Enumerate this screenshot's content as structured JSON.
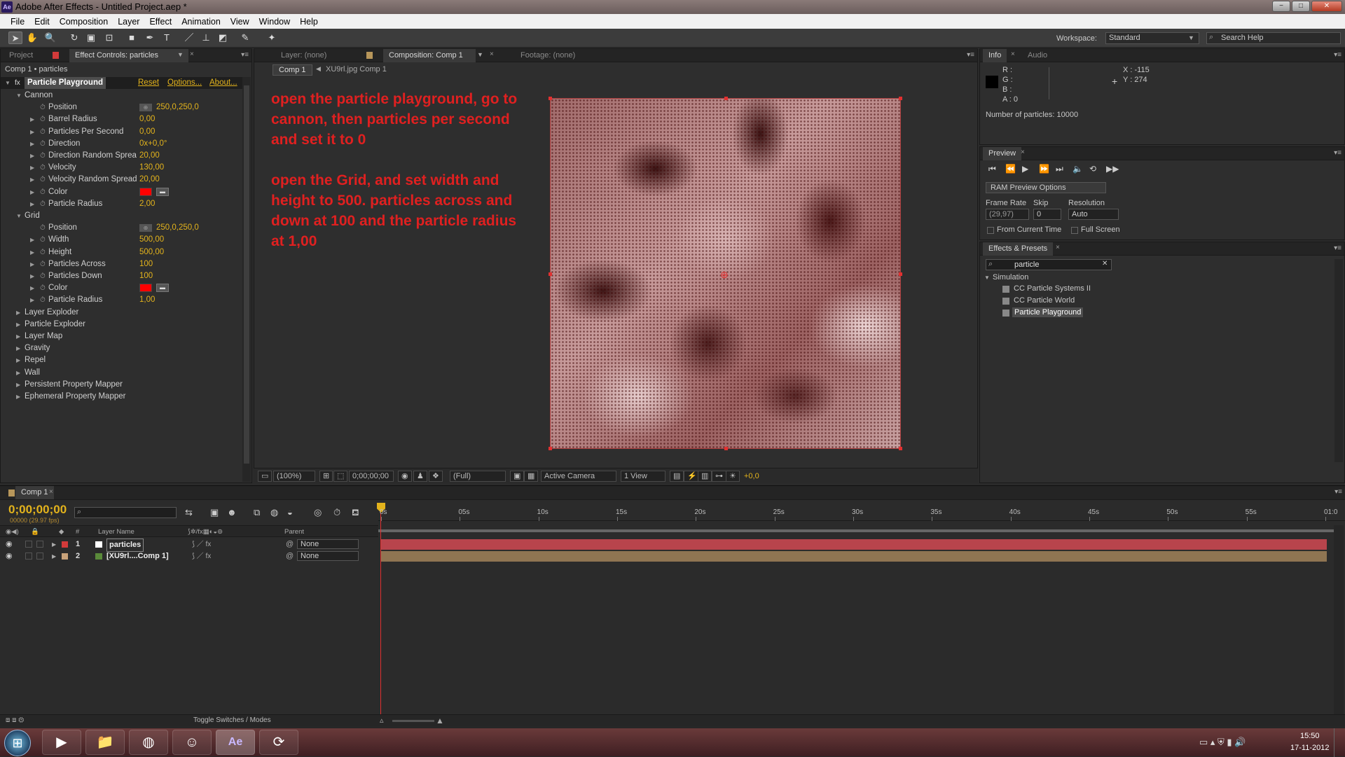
{
  "window": {
    "title": "Adobe After Effects - Untitled Project.aep *",
    "app_icon": "Ae",
    "controls": [
      "−",
      "□",
      "✕"
    ]
  },
  "menubar": [
    "File",
    "Edit",
    "Composition",
    "Layer",
    "Effect",
    "Animation",
    "View",
    "Window",
    "Help"
  ],
  "toolbar": {
    "workspace_label": "Workspace:",
    "workspace_value": "Standard",
    "search_placeholder": "Search Help"
  },
  "left_panel": {
    "tabs": [
      "Project",
      "Effect Controls: particles"
    ],
    "breadcrumb": "Comp 1 • particles",
    "effect_name": "Particle Playground",
    "effect_links": [
      "Reset",
      "Options...",
      "About..."
    ],
    "cannon": {
      "label": "Cannon",
      "props": [
        {
          "name": "Position",
          "value": "250,0,250,0"
        },
        {
          "name": "Barrel Radius",
          "value": "0,00"
        },
        {
          "name": "Particles Per Second",
          "value": "0,00"
        },
        {
          "name": "Direction",
          "value": "0x+0,0°"
        },
        {
          "name": "Direction Random Sprea",
          "value": "20,00"
        },
        {
          "name": "Velocity",
          "value": "130,00"
        },
        {
          "name": "Velocity Random Spread",
          "value": "20,00"
        },
        {
          "name": "Color",
          "value": ""
        },
        {
          "name": "Particle Radius",
          "value": "2,00"
        }
      ]
    },
    "grid": {
      "label": "Grid",
      "props": [
        {
          "name": "Position",
          "value": "250,0,250,0"
        },
        {
          "name": "Width",
          "value": "500,00"
        },
        {
          "name": "Height",
          "value": "500,00"
        },
        {
          "name": "Particles Across",
          "value": "100"
        },
        {
          "name": "Particles Down",
          "value": "100"
        },
        {
          "name": "Color",
          "value": ""
        },
        {
          "name": "Particle Radius",
          "value": "1,00"
        }
      ]
    },
    "groups": [
      "Layer Exploder",
      "Particle Exploder",
      "Layer Map",
      "Gravity",
      "Repel",
      "Wall",
      "Persistent Property Mapper",
      "Ephemeral Property Mapper"
    ]
  },
  "viewer": {
    "tabs": [
      "Layer: (none)",
      "Composition: Comp 1",
      "Footage: (none)"
    ],
    "flow": [
      "Comp 1",
      "XU9rl.jpg Comp 1"
    ],
    "instructions": [
      "open the particle playground, go to cannon, then particles per second and set it to 0",
      "open the Grid, and set width and height to 500. particles across and down at 100 and the particle radius at 1,00"
    ],
    "bar": {
      "zoom": "(100%)",
      "timecode": "0;00;00;00",
      "resolution": "(Full)",
      "camera": "Active Camera",
      "views": "1 View",
      "exposure": "+0,0"
    }
  },
  "info_panel": {
    "tabs": [
      "Info",
      "Audio"
    ],
    "r": "R :",
    "g": "G :",
    "b": "B :",
    "a": "A : 0",
    "x": "X : -115",
    "y": "Y : 274",
    "particles": "Number of particles: 10000"
  },
  "preview_panel": {
    "tab": "Preview",
    "ram_options": "RAM Preview Options",
    "frame_rate_label": "Frame Rate",
    "skip_label": "Skip",
    "resolution_label": "Resolution",
    "frame_rate": "(29,97)",
    "skip": "0",
    "resolution": "Auto",
    "from_current": "From Current Time",
    "full_screen": "Full Screen"
  },
  "effects_presets": {
    "tab": "Effects & Presets",
    "search": "particle",
    "category": "Simulation",
    "items": [
      "CC Particle Systems II",
      "CC Particle World",
      "Particle Playground"
    ]
  },
  "timeline": {
    "tab": "Comp 1",
    "timecode": "0;00;00;00",
    "fps": "00000 (29.97 fps)",
    "col_headers": {
      "num": "#",
      "layer_name": "Layer Name",
      "parent": "Parent"
    },
    "ruler": [
      "0s",
      "05s",
      "10s",
      "15s",
      "20s",
      "25s",
      "30s",
      "35s",
      "40s",
      "45s",
      "50s",
      "55s",
      "01:0"
    ],
    "layers": [
      {
        "num": "1",
        "name": "particles",
        "parent": "None",
        "label_color": "#d23a3a"
      },
      {
        "num": "2",
        "name": "[XU9rl....Comp 1]",
        "parent": "None",
        "label_color": "#c8a27a"
      }
    ],
    "toggle": "Toggle Switches / Modes"
  },
  "taskbar": {
    "time": "15:50",
    "date": "17-11-2012"
  }
}
